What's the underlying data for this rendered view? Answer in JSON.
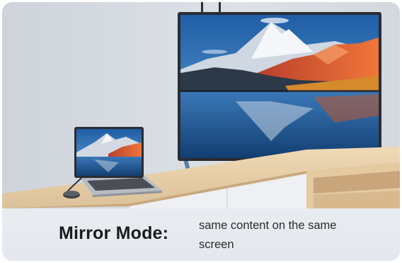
{
  "caption": {
    "title": "Mirror Mode:",
    "description": "same content on the same screen"
  },
  "colors": {
    "wall": "#d9dde4",
    "cabinet_wood": "#e6cda6",
    "cabinet_white": "#eef0f3",
    "tv_bezel": "#2a2d33",
    "sky": "#2f6fb3",
    "mountain_warm": "#e0502e",
    "lake": "#1f4f8a"
  },
  "icons": [
    "tv-illustration",
    "laptop-illustration",
    "adapter-icon"
  ]
}
